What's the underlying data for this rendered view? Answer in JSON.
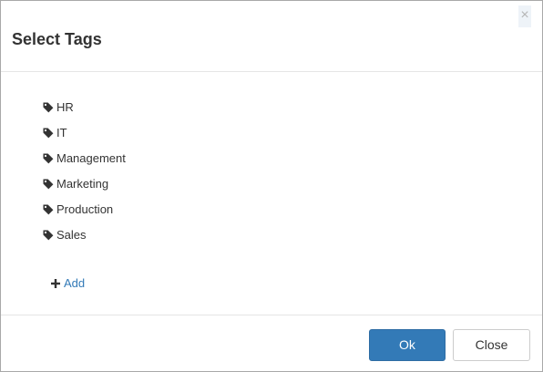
{
  "dialog": {
    "title": "Select Tags",
    "close_glyph": "×"
  },
  "tags": [
    {
      "label": "HR",
      "icon": "tag-icon"
    },
    {
      "label": "IT",
      "icon": "tag-icon"
    },
    {
      "label": "Management",
      "icon": "tag-icon"
    },
    {
      "label": "Marketing",
      "icon": "tag-icon"
    },
    {
      "label": "Production",
      "icon": "tag-icon"
    },
    {
      "label": "Sales",
      "icon": "tag-icon"
    }
  ],
  "add_link": {
    "label": "Add",
    "icon": "plus-icon"
  },
  "footer": {
    "ok_label": "Ok",
    "close_label": "Close"
  },
  "colors": {
    "primary": "#337ab7",
    "text": "#333333",
    "border": "#e5e5e5"
  }
}
